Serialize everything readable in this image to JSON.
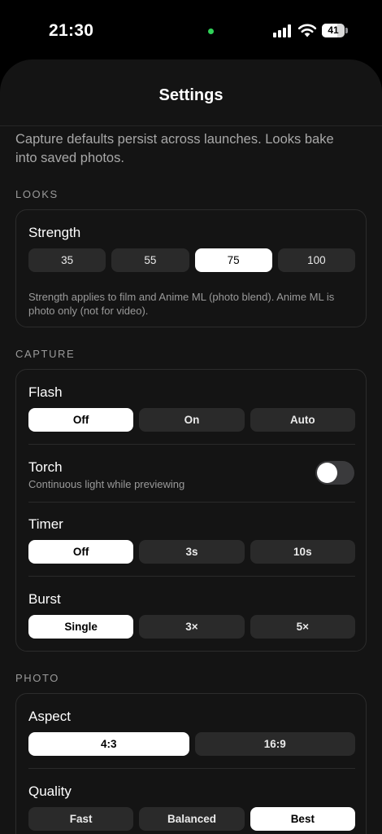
{
  "status_bar": {
    "time": "21:30",
    "battery_level": "41",
    "colors": {
      "camera_indicator": "#30d158"
    },
    "icons": [
      "signal-bars-icon",
      "wifi-icon",
      "battery-icon"
    ]
  },
  "header": {
    "title": "Settings"
  },
  "intro": "Capture defaults persist across launches. Looks bake into saved photos.",
  "looks": {
    "section_label": "LOOKS",
    "strength": {
      "label": "Strength",
      "options": [
        "35",
        "55",
        "75",
        "100"
      ],
      "selected": "75",
      "help": "Strength applies to film and Anime ML (photo blend). Anime ML is photo only (not for video)."
    }
  },
  "capture": {
    "section_label": "CAPTURE",
    "flash": {
      "label": "Flash",
      "options": [
        "Off",
        "On",
        "Auto"
      ],
      "selected": "Off"
    },
    "torch": {
      "label": "Torch",
      "subtitle": "Continuous light while previewing",
      "enabled": false
    },
    "timer": {
      "label": "Timer",
      "options": [
        "Off",
        "3s",
        "10s"
      ],
      "selected": "Off"
    },
    "burst": {
      "label": "Burst",
      "options": [
        "Single",
        "3×",
        "5×"
      ],
      "selected": "Single"
    }
  },
  "photo": {
    "section_label": "PHOTO",
    "aspect": {
      "label": "Aspect",
      "options": [
        "4:3",
        "16:9"
      ],
      "selected": "4:3"
    },
    "quality": {
      "label": "Quality",
      "options": [
        "Fast",
        "Balanced",
        "Best"
      ],
      "selected": "Best"
    }
  }
}
